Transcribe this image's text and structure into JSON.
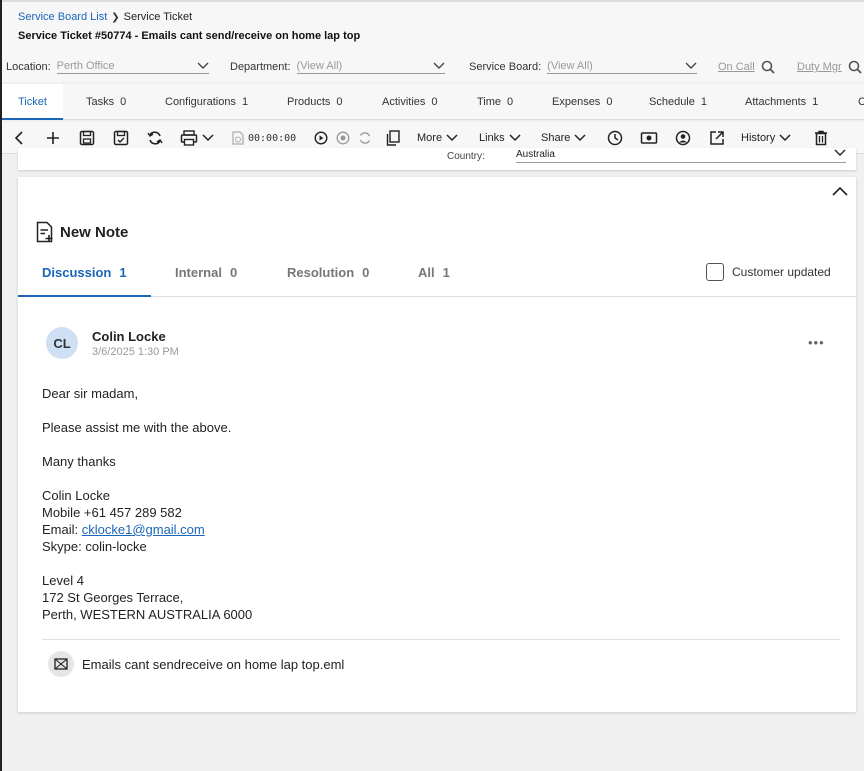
{
  "breadcrumb": {
    "parent": "Service Board List",
    "current": "Service Ticket"
  },
  "ticket": {
    "title": "Service Ticket #50774 - Emails cant send/receive on home lap top"
  },
  "filters": {
    "location_label": "Location:",
    "location_value": "Perth Office",
    "department_label": "Department:",
    "department_value": "(View All)",
    "board_label": "Service Board:",
    "board_value": "(View All)",
    "oncall": "On Call",
    "dutymgr": "Duty Mgr"
  },
  "tabs": [
    {
      "label": "Ticket",
      "count": ""
    },
    {
      "label": "Tasks",
      "count": "0"
    },
    {
      "label": "Configurations",
      "count": "1"
    },
    {
      "label": "Products",
      "count": "0"
    },
    {
      "label": "Activities",
      "count": "0"
    },
    {
      "label": "Time",
      "count": "0"
    },
    {
      "label": "Expenses",
      "count": "0"
    },
    {
      "label": "Schedule",
      "count": "1"
    },
    {
      "label": "Attachments",
      "count": "1"
    },
    {
      "label": "C",
      "count": ""
    }
  ],
  "toolbar": {
    "timer": "00:00:00",
    "more": "More",
    "links": "Links",
    "share": "Share",
    "history": "History"
  },
  "country": {
    "label": "Country:",
    "value": "Australia"
  },
  "notes": {
    "new_note": "New Note",
    "tabs": [
      {
        "label": "Discussion",
        "count": "1"
      },
      {
        "label": "Internal",
        "count": "0"
      },
      {
        "label": "Resolution",
        "count": "0"
      },
      {
        "label": "All",
        "count": "1"
      }
    ],
    "customer_updated": "Customer updated"
  },
  "note": {
    "initials": "CL",
    "author": "Colin Locke",
    "date": "3/6/2025 1:30 PM",
    "greeting": "Dear sir madam,",
    "line1": "Please assist me with the above.",
    "line2": "Many thanks",
    "sig_name": "Colin Locke",
    "sig_mobile": "Mobile +61 457 289 582",
    "sig_email_label": "Email: ",
    "sig_email": "cklocke1@gmail.com",
    "sig_skype": "Skype: colin-locke",
    "addr1": "Level 4",
    "addr2": "172 St  Georges Terrace,",
    "addr3": "Perth, WESTERN AUSTRALIA 6000"
  },
  "attachment": {
    "name": "Emails cant sendreceive on home lap top.eml"
  }
}
